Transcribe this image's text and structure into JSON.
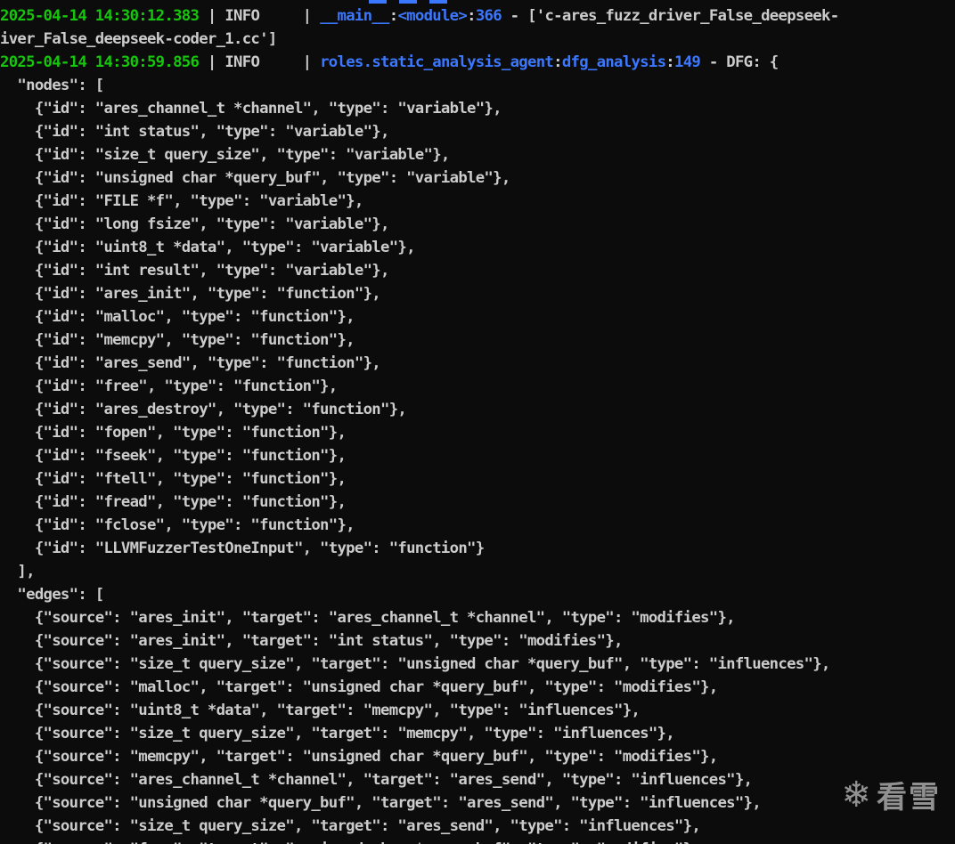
{
  "log": [
    {
      "timestamp": "2025-04-14 14:30:12.383",
      "level": "INFO",
      "module": "__main__",
      "function": "<module>",
      "lineno": "366",
      "message": "['c-ares_fuzz_driver_False_deepseek-",
      "continuation": "iver_False_deepseek-coder_1.cc']"
    },
    {
      "timestamp": "2025-04-14 14:30:59.856",
      "level": "INFO",
      "module": "roles.static_analysis_agent",
      "function": "dfg_analysis",
      "lineno": "149",
      "message": "DFG: {"
    }
  ],
  "dfg_lines": [
    "  \"nodes\": [",
    "    {\"id\": \"ares_channel_t *channel\", \"type\": \"variable\"},",
    "    {\"id\": \"int status\", \"type\": \"variable\"},",
    "    {\"id\": \"size_t query_size\", \"type\": \"variable\"},",
    "    {\"id\": \"unsigned char *query_buf\", \"type\": \"variable\"},",
    "    {\"id\": \"FILE *f\", \"type\": \"variable\"},",
    "    {\"id\": \"long fsize\", \"type\": \"variable\"},",
    "    {\"id\": \"uint8_t *data\", \"type\": \"variable\"},",
    "    {\"id\": \"int result\", \"type\": \"variable\"},",
    "    {\"id\": \"ares_init\", \"type\": \"function\"},",
    "    {\"id\": \"malloc\", \"type\": \"function\"},",
    "    {\"id\": \"memcpy\", \"type\": \"function\"},",
    "    {\"id\": \"ares_send\", \"type\": \"function\"},",
    "    {\"id\": \"free\", \"type\": \"function\"},",
    "    {\"id\": \"ares_destroy\", \"type\": \"function\"},",
    "    {\"id\": \"fopen\", \"type\": \"function\"},",
    "    {\"id\": \"fseek\", \"type\": \"function\"},",
    "    {\"id\": \"ftell\", \"type\": \"function\"},",
    "    {\"id\": \"fread\", \"type\": \"function\"},",
    "    {\"id\": \"fclose\", \"type\": \"function\"},",
    "    {\"id\": \"LLVMFuzzerTestOneInput\", \"type\": \"function\"}",
    "  ],",
    "  \"edges\": [",
    "    {\"source\": \"ares_init\", \"target\": \"ares_channel_t *channel\", \"type\": \"modifies\"},",
    "    {\"source\": \"ares_init\", \"target\": \"int status\", \"type\": \"modifies\"},",
    "    {\"source\": \"size_t query_size\", \"target\": \"unsigned char *query_buf\", \"type\": \"influences\"},",
    "    {\"source\": \"malloc\", \"target\": \"unsigned char *query_buf\", \"type\": \"modifies\"},",
    "    {\"source\": \"uint8_t *data\", \"target\": \"memcpy\", \"type\": \"influences\"},",
    "    {\"source\": \"size_t query_size\", \"target\": \"memcpy\", \"type\": \"influences\"},",
    "    {\"source\": \"memcpy\", \"target\": \"unsigned char *query_buf\", \"type\": \"modifies\"},",
    "    {\"source\": \"ares_channel_t *channel\", \"target\": \"ares_send\", \"type\": \"influences\"},",
    "    {\"source\": \"unsigned char *query_buf\", \"target\": \"ares_send\", \"type\": \"influences\"},",
    "    {\"source\": \"size_t query_size\", \"target\": \"ares_send\", \"type\": \"influences\"},",
    "    {\"source\": \"free\", \"target\": \"unsigned char *query_buf\", \"type\": \"modifies\"},"
  ],
  "watermark": {
    "icon": "snowflake-icon",
    "text": "看雪"
  },
  "colors": {
    "background": "#0c0c0c",
    "text": "#cccccc",
    "timestamp": "#16c60c",
    "module": "#3b78ff"
  }
}
